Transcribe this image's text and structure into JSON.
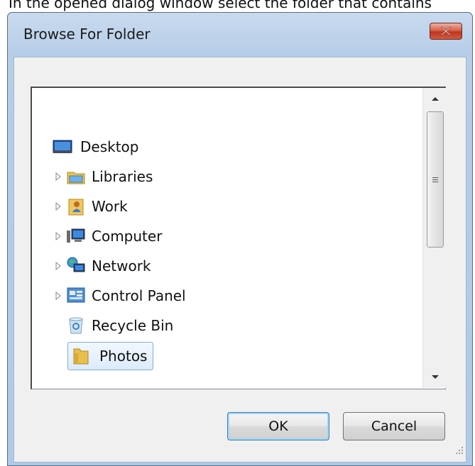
{
  "caption": "In the opened dialog window select the folder that contains",
  "dialog": {
    "title": "Browse For Folder",
    "ok_label": "OK",
    "cancel_label": "Cancel"
  },
  "tree": {
    "items": [
      {
        "label": "Desktop",
        "icon": "desktop-icon",
        "expandable": false,
        "selected": false
      },
      {
        "label": "Libraries",
        "icon": "libraries-icon",
        "expandable": true,
        "selected": false
      },
      {
        "label": "Work",
        "icon": "user-folder-icon",
        "expandable": true,
        "selected": false
      },
      {
        "label": "Computer",
        "icon": "computer-icon",
        "expandable": true,
        "selected": false
      },
      {
        "label": "Network",
        "icon": "network-icon",
        "expandable": true,
        "selected": false
      },
      {
        "label": "Control Panel",
        "icon": "control-panel-icon",
        "expandable": true,
        "selected": false
      },
      {
        "label": "Recycle Bin",
        "icon": "recycle-bin-icon",
        "expandable": false,
        "selected": false
      },
      {
        "label": "Photos",
        "icon": "folder-icon",
        "expandable": false,
        "selected": true
      }
    ]
  },
  "colors": {
    "close_button": "#c7402a",
    "selection_border": "#84acdd",
    "default_button_border": "#3c7fb1"
  }
}
